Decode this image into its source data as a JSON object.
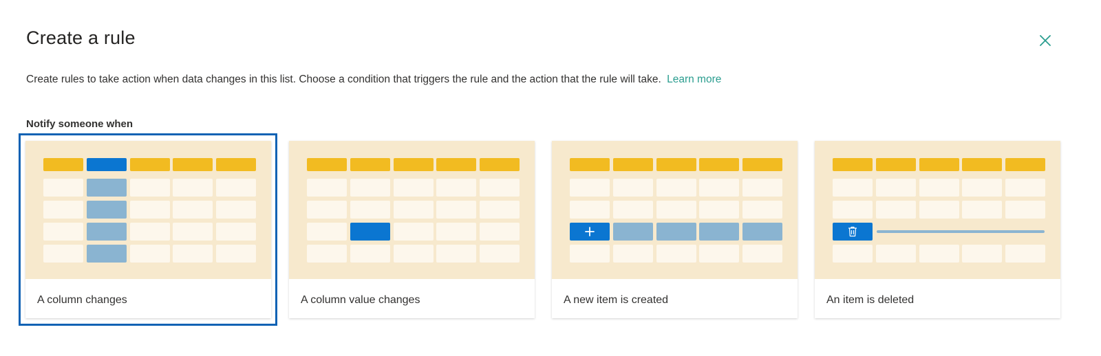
{
  "dialog": {
    "title": "Create a rule",
    "description": "Create rules to take action when data changes in this list. Choose a condition that triggers the rule and the action that the rule will take.",
    "learn_more": "Learn more",
    "section_label": "Notify someone when"
  },
  "cards": [
    {
      "label": "A column changes",
      "selected": true
    },
    {
      "label": "A column value changes",
      "selected": false
    },
    {
      "label": "A new item is created",
      "selected": false
    },
    {
      "label": "An item is deleted",
      "selected": false
    }
  ],
  "icons": {
    "close": "close-icon",
    "add": "plus-icon",
    "delete": "trash-icon"
  },
  "colors": {
    "accent": "#0b76d1",
    "link": "#2a9d8f",
    "header_cell": "#f2bb21",
    "thumb_bg": "#f7e9cd",
    "highlight_cell": "#8ab4d1",
    "selection_border": "#0f62b4"
  }
}
